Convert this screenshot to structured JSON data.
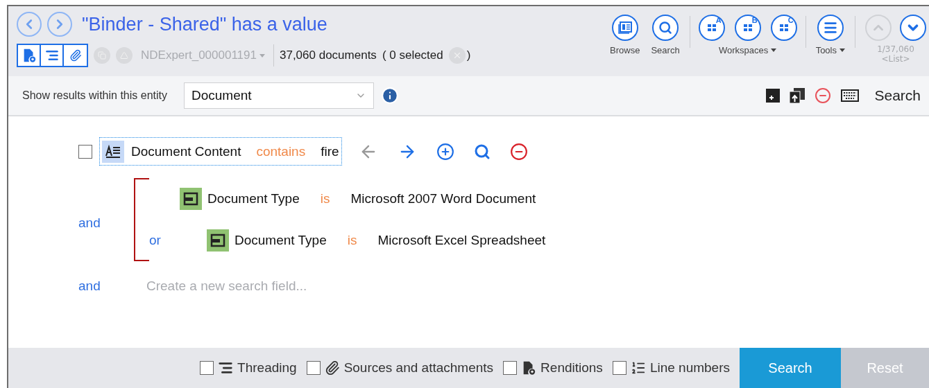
{
  "header": {
    "title": "\"Binder - Shared\" has a value",
    "nav": [
      {
        "kind": "back",
        "disabled": false
      },
      {
        "kind": "forward",
        "disabled": false
      }
    ],
    "view_toggles": [
      {
        "kind": "renditions"
      },
      {
        "kind": "threading"
      },
      {
        "kind": "attachments"
      }
    ],
    "binder": {
      "name": "NDExpert_000001191",
      "disabled": true
    },
    "count": "37,060 documents",
    "selected_open": "( 0 selected",
    "selected_close": ")",
    "toolbar": [
      {
        "kind": "browse",
        "label": "Browse"
      },
      {
        "kind": "search",
        "label": "Search"
      },
      {
        "kind": "workspace",
        "letter": "A"
      },
      {
        "kind": "workspace",
        "letter": "B"
      },
      {
        "kind": "workspace",
        "letter": "C"
      },
      {
        "kind": "tools",
        "label": "Tools"
      }
    ],
    "workspaces_label": "Workspaces",
    "position": {
      "count": "1/37,060",
      "list": "<List>",
      "up_disabled": true,
      "down_disabled": false
    }
  },
  "filter_bar": {
    "label": "Show results within this entity",
    "entity": "Document",
    "search_label": "Search"
  },
  "query": {
    "first": {
      "checked": false,
      "field": "Document Content",
      "operator": "contains",
      "value": "fire"
    },
    "group": {
      "connector": "and",
      "rows": [
        {
          "field": "Document Type",
          "operator": "is",
          "value": "Microsoft 2007 Word Document"
        },
        {
          "connector": "or",
          "field": "Document Type",
          "operator": "is",
          "value": "Microsoft Excel Spreadsheet"
        }
      ]
    },
    "new_field": {
      "connector": "and",
      "placeholder": "Create a new search field..."
    }
  },
  "footer": {
    "options": [
      {
        "kind": "threading",
        "label": "Threading",
        "checked": false
      },
      {
        "kind": "attachments",
        "label": "Sources and attachments",
        "checked": false
      },
      {
        "kind": "renditions",
        "label": "Renditions",
        "checked": false
      },
      {
        "kind": "lines",
        "label": "Line numbers",
        "checked": false
      }
    ],
    "search_button": "Search",
    "reset_button": {
      "label": "Reset",
      "disabled": true
    }
  }
}
